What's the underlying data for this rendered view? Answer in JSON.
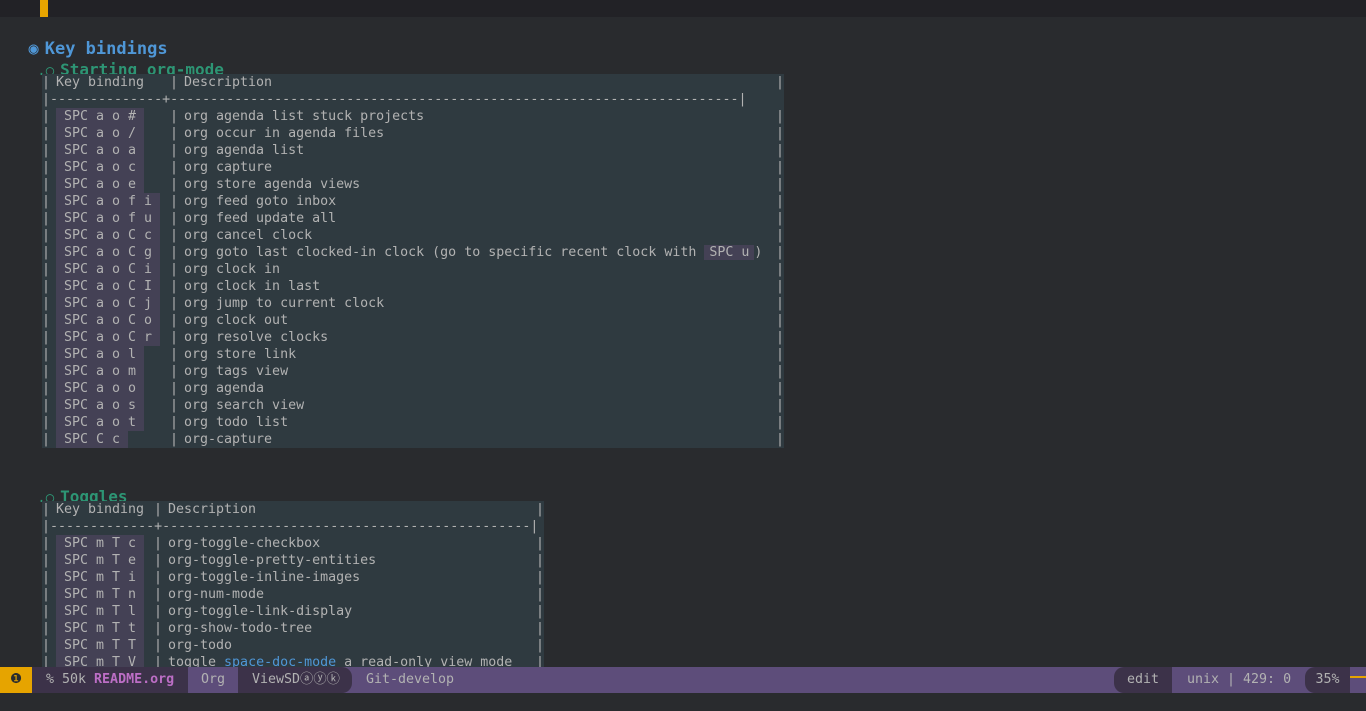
{
  "heading1": {
    "bullet": "◉",
    "text": "Key bindings"
  },
  "section1": {
    "bullet": ".○",
    "title": "Starting org-mode",
    "header_key": "Key binding",
    "header_desc": "Description",
    "separator": "|--------------+-----------------------------------------------------------------------|",
    "rows": [
      {
        "key": "SPC a o #",
        "desc": "org agenda list stuck projects"
      },
      {
        "key": "SPC a o /",
        "desc": "org occur in agenda files"
      },
      {
        "key": "SPC a o a",
        "desc": "org agenda list"
      },
      {
        "key": "SPC a o c",
        "desc": "org capture"
      },
      {
        "key": "SPC a o e",
        "desc": "org store agenda views"
      },
      {
        "key": "SPC a o f i",
        "desc": "org feed goto inbox"
      },
      {
        "key": "SPC a o f u",
        "desc": "org feed update all"
      },
      {
        "key": "SPC a o C c",
        "desc": "org cancel clock"
      },
      {
        "key": "SPC a o C g",
        "desc": "org goto last clocked-in clock (go to specific recent clock with",
        "inline_key": "SPC u",
        "desc_after": ")"
      },
      {
        "key": "SPC a o C i",
        "desc": "org clock in"
      },
      {
        "key": "SPC a o C I",
        "desc": "org clock in last"
      },
      {
        "key": "SPC a o C j",
        "desc": "org jump to current clock"
      },
      {
        "key": "SPC a o C o",
        "desc": "org clock out"
      },
      {
        "key": "SPC a o C r",
        "desc": "org resolve clocks"
      },
      {
        "key": "SPC a o l",
        "desc": "org store link"
      },
      {
        "key": "SPC a o m",
        "desc": "org tags view"
      },
      {
        "key": "SPC a o o",
        "desc": "org agenda"
      },
      {
        "key": "SPC a o s",
        "desc": "org search view"
      },
      {
        "key": "SPC a o t",
        "desc": "org todo list"
      },
      {
        "key": "SPC C c",
        "desc": "org-capture"
      }
    ]
  },
  "section2": {
    "bullet": ".○",
    "title": "Toggles",
    "header_key": "Key binding",
    "header_desc": "Description",
    "separator": "|-------------+----------------------------------------------|",
    "rows": [
      {
        "key": "SPC m T c",
        "desc": "org-toggle-checkbox"
      },
      {
        "key": "SPC m T e",
        "desc": "org-toggle-pretty-entities"
      },
      {
        "key": "SPC m T i",
        "desc": "org-toggle-inline-images"
      },
      {
        "key": "SPC m T n",
        "desc": "org-num-mode"
      },
      {
        "key": "SPC m T l",
        "desc": "org-toggle-link-display"
      },
      {
        "key": "SPC m T t",
        "desc": "org-show-todo-tree"
      },
      {
        "key": "SPC m T T",
        "desc": "org-todo"
      },
      {
        "key": "SPC m T V",
        "desc": "toggle ",
        "link": "space-doc-mode",
        "desc_after": " a read-only view mode"
      }
    ]
  },
  "modeline": {
    "state_icon": "❶",
    "buffer_info": "% 50k",
    "filename": "README.org",
    "major_mode": "Org",
    "minor_modes": "ViewSDⓐⓨⓚ",
    "vcs": "Git-develop",
    "evil_state": "edit",
    "encoding_pos": "unix | 429: 0",
    "percent": "35%",
    "colors": {
      "bar": "#5d4d7a",
      "dark": "#3c3249",
      "accent": "#e6a400",
      "filename": "#bc6ec5"
    }
  }
}
